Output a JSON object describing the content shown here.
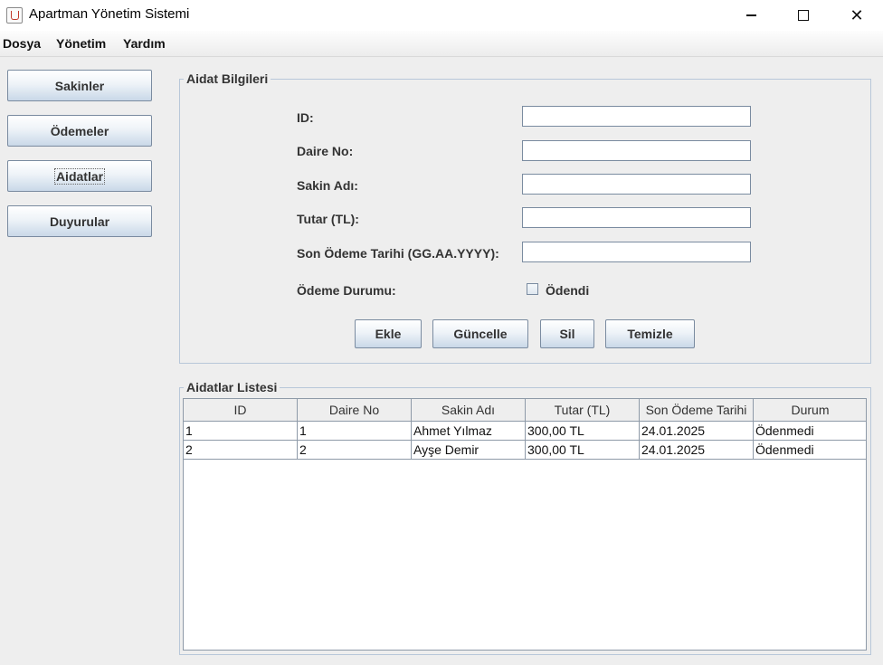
{
  "window": {
    "title": "Apartman Yönetim Sistemi",
    "minimize_icon": "minimize-icon",
    "maximize_icon": "maximize-icon",
    "close_glyph": "✕"
  },
  "menu": {
    "items": [
      "Dosya",
      "Yönetim",
      "Yardım"
    ]
  },
  "sidebar": {
    "buttons": [
      "Sakinler",
      "Ödemeler",
      "Aidatlar",
      "Duyurular"
    ],
    "selected": "Aidatlar"
  },
  "form": {
    "title": "Aidat Bilgileri",
    "fields": [
      {
        "label": "ID:",
        "value": ""
      },
      {
        "label": "Daire No:",
        "value": ""
      },
      {
        "label": "Sakin Adı:",
        "value": ""
      },
      {
        "label": "Tutar (TL):",
        "value": ""
      },
      {
        "label": "Son Ödeme Tarihi (GG.AA.YYYY):",
        "value": ""
      }
    ],
    "status_label": "Ödeme Durumu:",
    "checkbox_label": "Ödendi",
    "checkbox_checked": false,
    "buttons": [
      "Ekle",
      "Güncelle",
      "Sil",
      "Temizle"
    ]
  },
  "table": {
    "title": "Aidatlar Listesi",
    "columns": [
      "ID",
      "Daire No",
      "Sakin Adı",
      "Tutar (TL)",
      "Son Ödeme Tarihi",
      "Durum"
    ],
    "rows": [
      [
        "1",
        "1",
        "Ahmet Yılmaz",
        "300,00 TL",
        "24.01.2025",
        "Ödenmedi"
      ],
      [
        "2",
        "2",
        "Ayşe Demir",
        "300,00 TL",
        "24.01.2025",
        "Ödenmedi"
      ]
    ]
  },
  "colors": {
    "accent_border": "#7a8ba0",
    "button_gradient_end": "#c9d8e8",
    "group_border": "#b8c7d9"
  }
}
